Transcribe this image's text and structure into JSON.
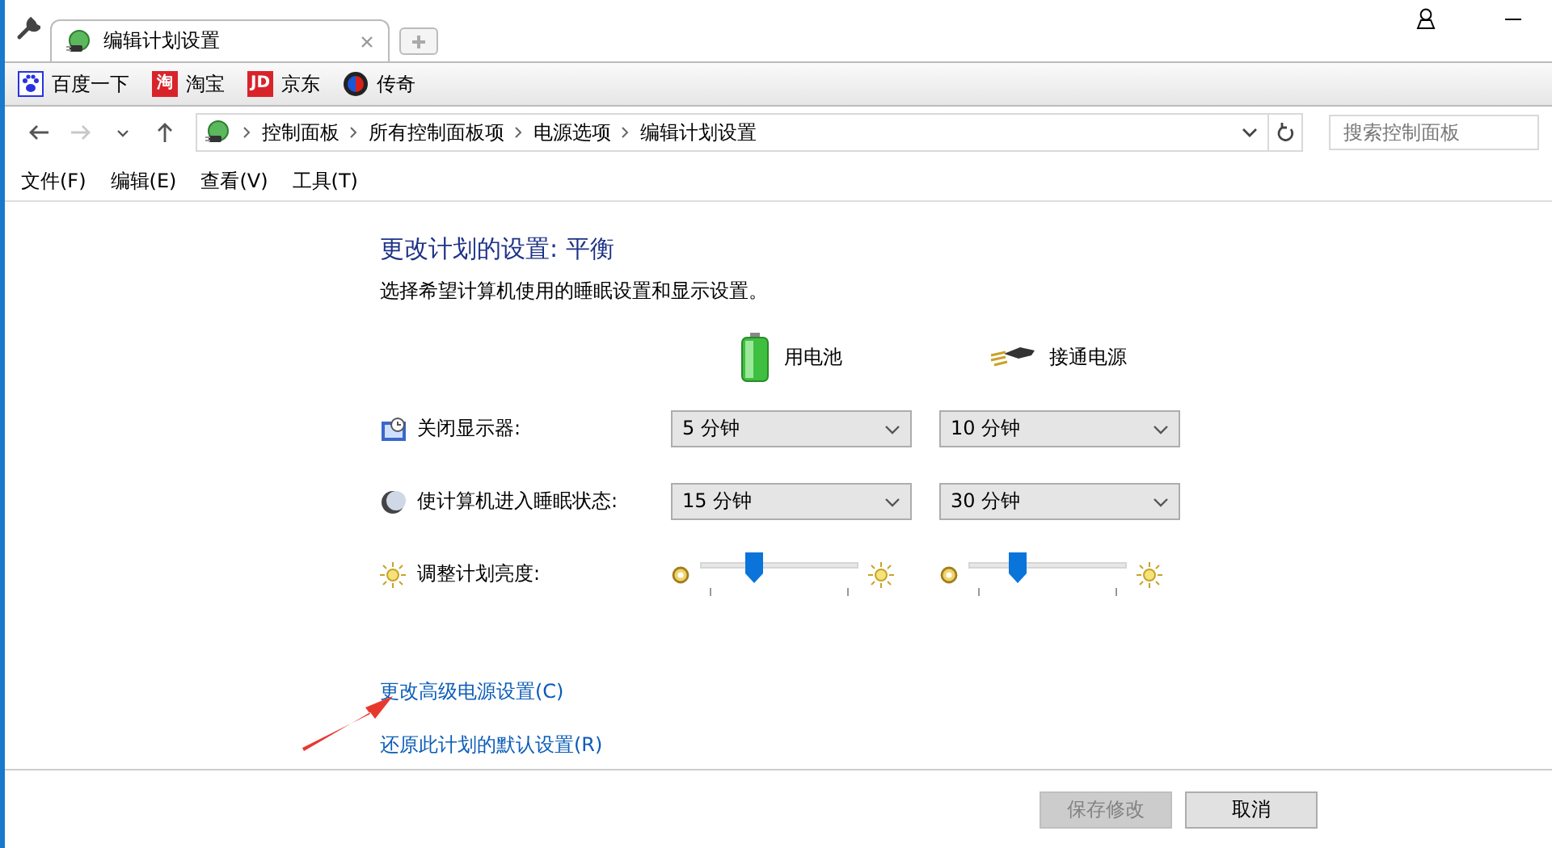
{
  "browser": {
    "tab": {
      "title": "编辑计划设置",
      "selected": true
    },
    "bookmarks": [
      {
        "kind": "paw",
        "label": "百度一下"
      },
      {
        "kind": "text-logo",
        "logo": "淘",
        "label": "淘宝"
      },
      {
        "kind": "text-logo",
        "logo": "JD",
        "label": "京东"
      },
      {
        "kind": "orb",
        "label": "传奇"
      }
    ]
  },
  "address_bar": {
    "nav": [
      {
        "kind": "back",
        "disabled": false
      },
      {
        "kind": "forward",
        "disabled": true
      },
      {
        "kind": "recent",
        "disabled": false
      },
      {
        "kind": "up",
        "disabled": false
      }
    ],
    "breadcrumb": [
      "控制面板",
      "所有控制面板项",
      "电源选项",
      "编辑计划设置"
    ],
    "search": {
      "placeholder": "搜索控制面板"
    }
  },
  "menu": [
    "文件(F)",
    "编辑(E)",
    "查看(V)",
    "工具(T)"
  ],
  "content": {
    "title": "更改计划的设置: 平衡",
    "subtitle": "选择希望计算机使用的睡眠设置和显示设置。",
    "columns": [
      {
        "kind": "battery",
        "label": "用电池"
      },
      {
        "kind": "plug",
        "label": "接通电源"
      }
    ],
    "settings": [
      {
        "kind": "select",
        "label": "关闭显示器:",
        "values": [
          {
            "value": "5 分钟"
          },
          {
            "value": "10 分钟"
          }
        ]
      },
      {
        "kind": "select",
        "label": "使计算机进入睡眠状态:",
        "values": [
          {
            "value": "15 分钟"
          },
          {
            "value": "30 分钟"
          }
        ]
      },
      {
        "kind": "slider",
        "label": "调整计划亮度:",
        "values": [
          {
            "level": 0.31
          },
          {
            "level": 0.28
          }
        ]
      }
    ],
    "links": [
      "更改高级电源设置(C)",
      "还原此计划的默认设置(R)"
    ],
    "annotation": {
      "kind": "arrow"
    }
  },
  "buttons": [
    {
      "label": "保存修改",
      "disabled": true
    },
    {
      "label": "取消",
      "disabled": false
    }
  ]
}
